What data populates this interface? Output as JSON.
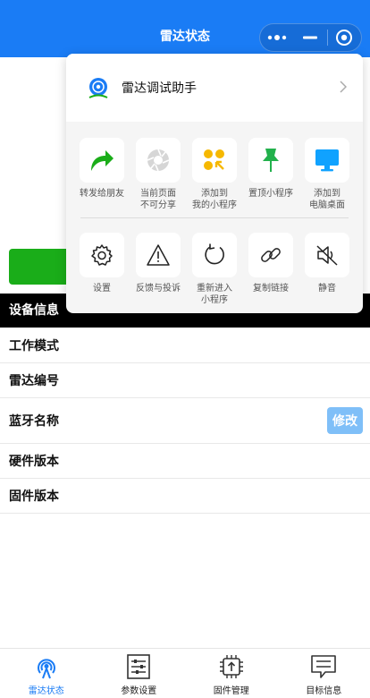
{
  "navbar": {
    "title": "雷达状态"
  },
  "page": {
    "section_title": "设备信息",
    "rows": [
      {
        "label": "工作模式"
      },
      {
        "label": "雷达编号"
      },
      {
        "label": "蓝牙名称",
        "action": "修改"
      },
      {
        "label": "硬件版本"
      },
      {
        "label": "固件版本"
      }
    ]
  },
  "popup": {
    "app_name": "雷达调试助手",
    "row1": [
      {
        "label": "转发给朋友",
        "icon": "share-icon"
      },
      {
        "label": "当前页面\n不可分享",
        "icon": "shutter-icon"
      },
      {
        "label": "添加到\n我的小程序",
        "icon": "add-mini-program-icon"
      },
      {
        "label": "置顶小程序",
        "icon": "pin-icon"
      },
      {
        "label": "添加到\n电脑桌面",
        "icon": "monitor-icon"
      }
    ],
    "row2": [
      {
        "label": "设置",
        "icon": "gear-icon"
      },
      {
        "label": "反馈与投诉",
        "icon": "warning-icon"
      },
      {
        "label": "重新进入\n小程序",
        "icon": "reload-icon"
      },
      {
        "label": "复制链接",
        "icon": "link-icon"
      },
      {
        "label": "静音",
        "icon": "mute-icon"
      }
    ]
  },
  "tabbar": {
    "tabs": [
      {
        "label": "雷达状态",
        "icon": "radar-icon",
        "active": true
      },
      {
        "label": "参数设置",
        "icon": "sliders-icon"
      },
      {
        "label": "固件管理",
        "icon": "chip-icon"
      },
      {
        "label": "目标信息",
        "icon": "message-icon"
      }
    ]
  },
  "colors": {
    "accent": "#1a7cf5",
    "green": "#1aad19",
    "share_green": "#1aad19",
    "pin_green": "#22b14c",
    "yellow": "#f6b800",
    "monitor_blue": "#10a2ff",
    "edit_button": "#7fbff8"
  }
}
